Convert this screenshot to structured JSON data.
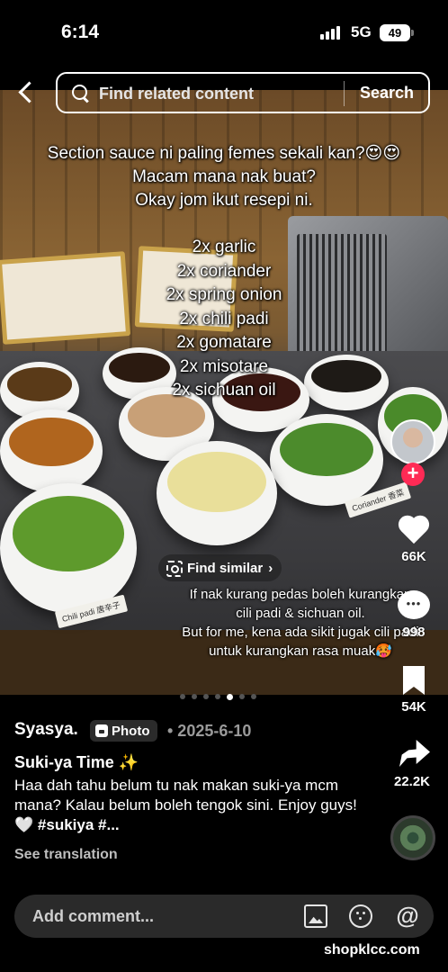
{
  "status_bar": {
    "time": "6:14",
    "network": "5G",
    "battery": "49"
  },
  "header": {
    "search_placeholder": "Find related content",
    "search_button": "Search"
  },
  "overlay": {
    "lines_top": [
      "Section sauce ni paling femes sekali kan?😍😍",
      "Macam mana nak buat?",
      "Okay jom ikut resepi ni."
    ],
    "recipe": [
      "2x  garlic",
      "2x  coriander",
      "2x  spring onion",
      "2x  chili padi",
      "2x gomatare",
      "2x misotare",
      "2x sichuan oil"
    ],
    "note_lines": [
      "If nak kurang pedas boleh kurangkan",
      "cili padi & sichuan oil.",
      "But for me, kena ada sikit jugak cili padi",
      "untuk kurangkan rasa muak🥵"
    ],
    "find_similar": "Find similar",
    "tag_chili": "Chili padi 唐辛子",
    "tag_coriander": "Coriander 香菜"
  },
  "rail": {
    "likes": "66K",
    "comments": "998",
    "saves": "54K",
    "shares": "22.2K"
  },
  "carousel": {
    "total": 7,
    "active": 5
  },
  "post": {
    "author": "Syasya.",
    "type": "Photo",
    "date": "• 2025-6-10",
    "title": "Suki-ya Time ✨",
    "body": "Haa dah tahu belum tu nak makan suki-ya mcm mana? Kalau belum boleh tengok sini. Enjoy guys!🤍",
    "tags": "#sukiya #...",
    "see_translation": "See translation"
  },
  "comment_bar": {
    "placeholder": "Add comment..."
  },
  "watermark": "shopklcc.com",
  "colors": {
    "follow": "#ff2a55",
    "background": "#000000"
  }
}
